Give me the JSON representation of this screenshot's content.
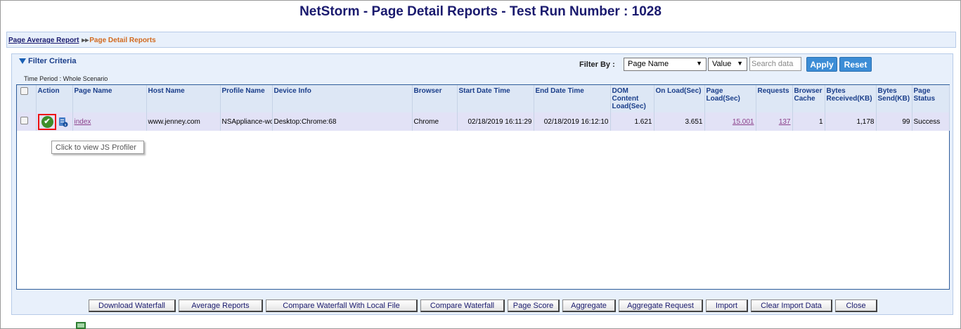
{
  "title": "NetStorm - Page Detail Reports - Test Run Number : 1028",
  "breadcrumb": {
    "link": "Page Average Report",
    "separator": "▸▸",
    "current": "Page Detail Reports"
  },
  "filter": {
    "section_title": "Filter Criteria",
    "filter_by_label": "Filter By :",
    "field_select": "Page Name",
    "value_select": "Value",
    "search_placeholder": "Search data",
    "apply_label": "Apply",
    "reset_label": "Reset",
    "time_period": "Time Period : Whole Scenario"
  },
  "table": {
    "columns": {
      "action": "Action",
      "page_name": "Page Name",
      "host_name": "Host Name",
      "profile_name": "Profile Name",
      "device_info": "Device Info",
      "browser": "Browser",
      "start": "Start Date Time",
      "end": "End Date Time",
      "dom": "DOM Content Load(Sec)",
      "onload": "On Load(Sec)",
      "pageload": "Page Load(Sec)",
      "requests": "Requests",
      "cache": "Browser Cache",
      "received": "Bytes Received(KB)",
      "send": "Bytes Send(KB)",
      "status": "Page Status"
    },
    "rows": [
      {
        "page_name": "index",
        "host_name": "www.jenney.com",
        "profile_name": "NSAppliance-wo",
        "device_info": "Desktop:Chrome:68",
        "browser": "Chrome",
        "start": "02/18/2019 16:11:29",
        "end": "02/18/2019 16:12:10",
        "dom": "1.621",
        "onload": "3.651",
        "pageload": "15.001",
        "requests": "137",
        "cache": "1",
        "received": "1,178",
        "send": "99",
        "status": "Success"
      }
    ]
  },
  "tooltip": "Click to view JS Profiler",
  "icons": {
    "check": "check-circle-icon",
    "doc": "document-info-icon"
  },
  "buttons": {
    "download_waterfall": "Download Waterfall",
    "average_reports": "Average Reports",
    "compare_local": "Compare Waterfall With Local File",
    "compare_waterfall": "Compare Waterfall",
    "page_score": "Page Score",
    "aggregate": "Aggregate",
    "aggregate_request": "Aggregate Request",
    "import": "Import",
    "clear_import": "Clear Import Data",
    "close": "Close"
  }
}
